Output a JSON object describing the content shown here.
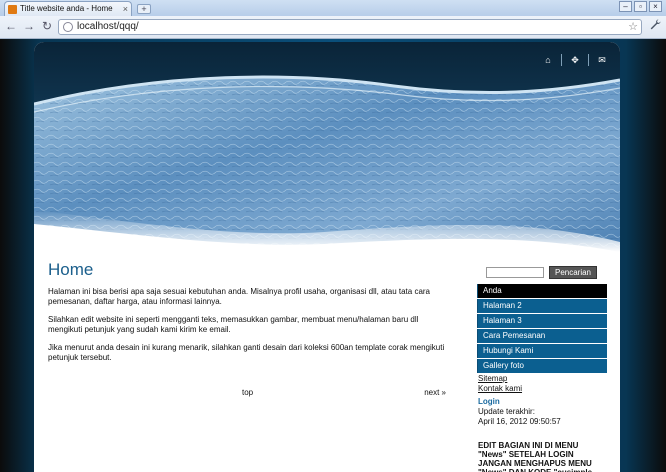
{
  "browser": {
    "tab_title": "Title website anda - Home",
    "tab_close": "×",
    "new_tab": "+",
    "url": "localhost/qqq/",
    "window_buttons": {
      "minimize": "–",
      "restore": "▫",
      "close": "×"
    },
    "nav": {
      "back": "←",
      "forward": "→",
      "reload": "↻",
      "star": "☆",
      "wrench": "🔧"
    }
  },
  "header": {
    "icons": [
      "home-icon",
      "sitemap-icon",
      "mail-icon"
    ],
    "icon_glyphs": {
      "home": "⌂",
      "sitemap": "✥",
      "mail": "✉"
    }
  },
  "main": {
    "title": "Home",
    "paragraphs": [
      "Halaman ini bisa berisi apa saja sesuai kebutuhan anda. Misalnya profil usaha, organisasi dll, atau tata cara pemesanan, daftar harga, atau informasi lainnya.",
      "Silahkan edit website ini seperti mengganti teks, memasukkan gambar, membuat menu/halaman baru dll mengikuti petunjuk yang sudah kami kirim ke email.",
      "Jika menurut anda desain ini kurang menarik, silahkan ganti desain dari koleksi 600an template corak mengikuti petunjuk tersebut."
    ],
    "pager": {
      "top": "top",
      "next": "next »"
    }
  },
  "sidebar": {
    "search_placeholder": "",
    "search_button": "Pencarian",
    "menu": [
      {
        "label": "Anda",
        "active": true
      },
      {
        "label": "Halaman 2",
        "active": false
      },
      {
        "label": "Halaman 3",
        "active": false
      },
      {
        "label": "Cara Pemesanan",
        "active": false
      },
      {
        "label": "Hubungi Kami",
        "active": false
      },
      {
        "label": "Gallery foto",
        "active": false
      }
    ],
    "links": [
      "Sitemap",
      "Kontak kami"
    ],
    "login": "Login",
    "updated_label": "Update terakhir:",
    "updated_value": "April 16, 2012 09:50:57",
    "notice": "EDIT BAGIAN INI DI MENU \"News\" SETELAH LOGIN JANGAN MENGHAPUS MENU \"News\" DAN KODE \"cusimple"
  },
  "colors": {
    "accent": "#1b5f8c",
    "menu": "#0b5f90",
    "menu_active": "#000000"
  }
}
